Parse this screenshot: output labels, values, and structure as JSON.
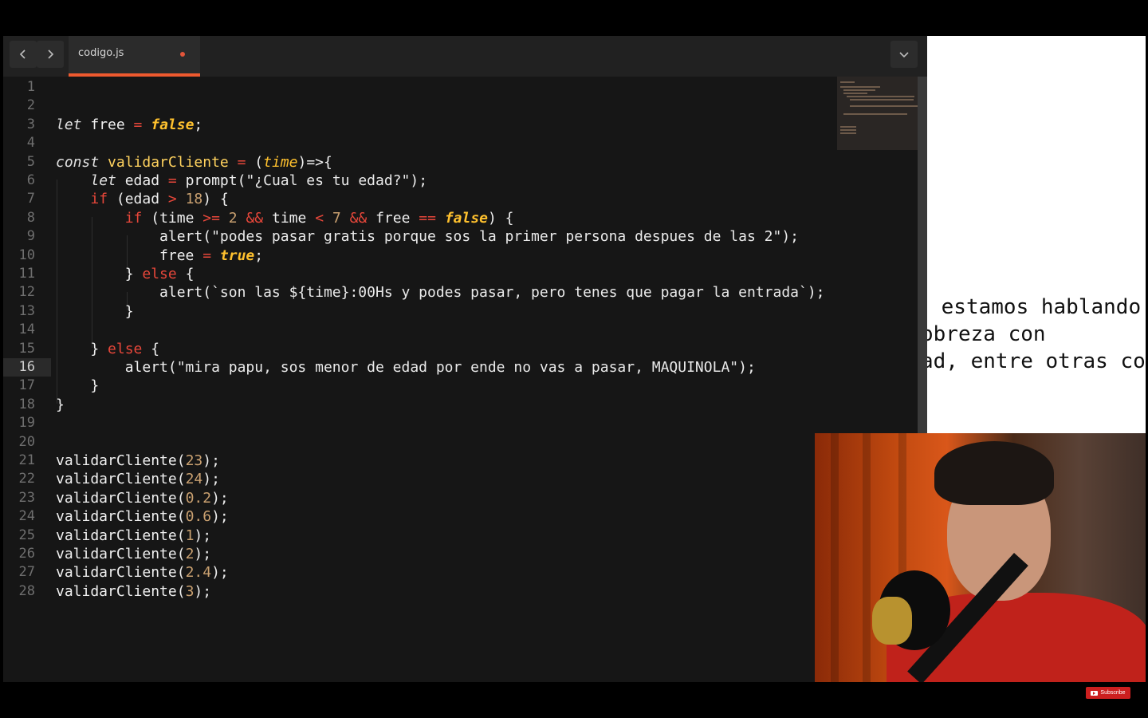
{
  "tab": {
    "filename": "codigo.js"
  },
  "editor": {
    "active_line": 16,
    "lines": [
      {
        "n": "1",
        "html": ""
      },
      {
        "n": "2",
        "html": ""
      },
      {
        "n": "3",
        "html": "<span class='kwi'>let</span> free <span class='op'>=</span> <span class='bool'>false</span>;"
      },
      {
        "n": "4",
        "html": ""
      },
      {
        "n": "5",
        "html": "<span class='kwi'>const</span> <span class='fn'>validarCliente</span> <span class='op'>=</span> (<span class='param'>time</span>)=>{"
      },
      {
        "n": "6",
        "html": "    <span class='kwi'>let</span> edad <span class='op'>=</span> prompt(<span class='str'>\"¿Cual es tu edad?\"</span>);"
      },
      {
        "n": "7",
        "html": "    <span class='kw'>if</span> (edad <span class='op'>&gt;</span> <span class='num'>18</span>) {"
      },
      {
        "n": "8",
        "html": "        <span class='kw'>if</span> (time <span class='op'>&gt;=</span> <span class='num'>2</span> <span class='op'>&amp;&amp;</span> time <span class='op'>&lt;</span> <span class='num'>7</span> <span class='op'>&amp;&amp;</span> free <span class='op'>==</span> <span class='bool'>false</span>) {"
      },
      {
        "n": "9",
        "html": "            alert(<span class='str'>\"podes pasar gratis porque sos la primer persona despues de las 2\"</span>);"
      },
      {
        "n": "10",
        "html": "            free <span class='op'>=</span> <span class='bool'>true</span>;"
      },
      {
        "n": "11",
        "html": "        } <span class='kw'>else</span> {"
      },
      {
        "n": "12",
        "html": "            alert(<span class='tpl'>`son las ${time}:00Hs y podes pasar, pero tenes que pagar la entrada`</span>);"
      },
      {
        "n": "13",
        "html": "        }"
      },
      {
        "n": "14",
        "html": ""
      },
      {
        "n": "15",
        "html": "    } <span class='kw'>else</span> {"
      },
      {
        "n": "16",
        "html": "        alert(<span class='str'>\"mira papu, sos menor de edad por ende no vas a pasar, MAQUINOLA\"</span>);"
      },
      {
        "n": "17",
        "html": "    }"
      },
      {
        "n": "18",
        "html": "}"
      },
      {
        "n": "19",
        "html": ""
      },
      {
        "n": "20",
        "html": ""
      },
      {
        "n": "21",
        "html": "validarCliente(<span class='num'>23</span>);"
      },
      {
        "n": "22",
        "html": "validarCliente(<span class='num'>24</span>);"
      },
      {
        "n": "23",
        "html": "validarCliente(<span class='num'>0.2</span>);"
      },
      {
        "n": "24",
        "html": "validarCliente(<span class='num'>0.6</span>);"
      },
      {
        "n": "25",
        "html": "validarCliente(<span class='num'>1</span>);"
      },
      {
        "n": "26",
        "html": "validarCliente(<span class='num'>2</span>);"
      },
      {
        "n": "27",
        "html": "validarCliente(<span class='num'>2.4</span>);"
      },
      {
        "n": "28",
        "html": "validarCliente(<span class='num'>3</span>);"
      }
    ]
  },
  "document": {
    "lines": [
      " estamos hablando",
      "obreza con",
      "ad, entre otras co"
    ]
  },
  "overlay": {
    "subscribe_label": "Subscribe"
  },
  "colors": {
    "accent": "#ee5a2f",
    "keyword": "#e8473a",
    "function": "#ffd25e",
    "boolean": "#ffc12e",
    "number": "#c9a070"
  },
  "icons": [
    "chevron-left-icon",
    "chevron-right-icon",
    "chevron-down-icon",
    "unsaved-dot-icon",
    "youtube-icon"
  ]
}
